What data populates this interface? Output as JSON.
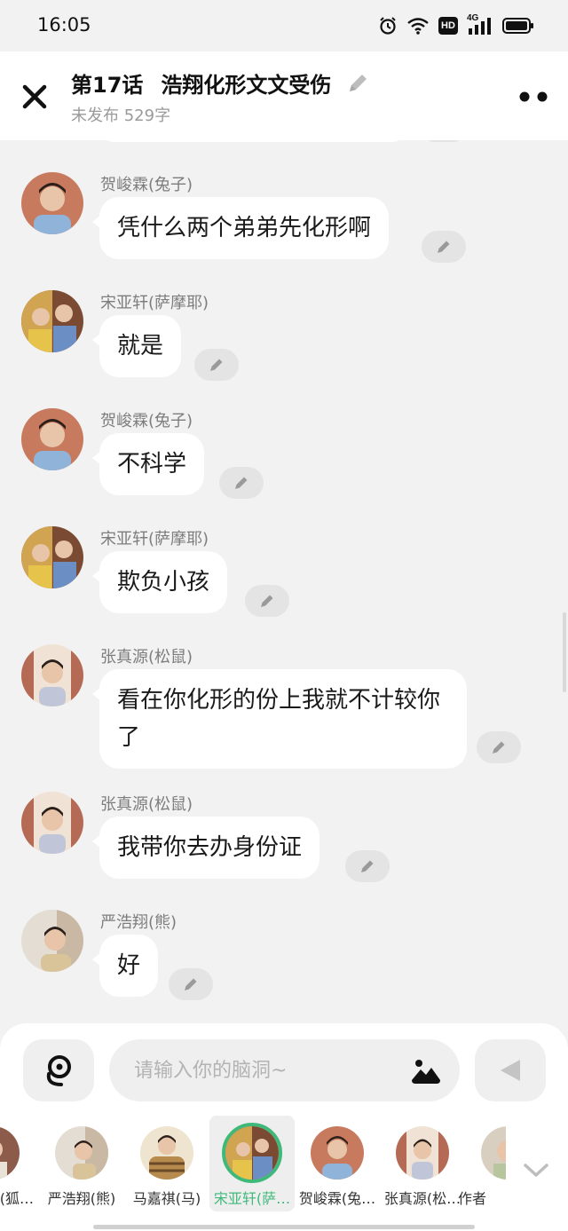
{
  "status_bar": {
    "time": "16:05",
    "icons": [
      "alarm-icon",
      "wifi-icon",
      "hd-icon",
      "4g-signal-icon",
      "battery-icon"
    ],
    "hd_label": "HD",
    "network_label": "4G"
  },
  "header": {
    "episode": "第17话",
    "title": "浩翔化形文文受伤",
    "subtitle": "未发布 529字"
  },
  "messages": [
    {
      "sender": "贺峻霖(兔子)",
      "text": "凭什么两个弟弟先化形啊",
      "avatar_color": "#c77a5e"
    },
    {
      "sender": "宋亚轩(萨摩耶)",
      "text": "就是",
      "avatar_color": "#d1a451"
    },
    {
      "sender": "贺峻霖(兔子)",
      "text": "不科学",
      "avatar_color": "#c77a5e"
    },
    {
      "sender": "宋亚轩(萨摩耶)",
      "text": "欺负小孩",
      "avatar_color": "#d1a451"
    },
    {
      "sender": "张真源(松鼠)",
      "text": "看在你化形的份上我就不计较你了",
      "avatar_color": "#b56a55"
    },
    {
      "sender": "张真源(松鼠)",
      "text": "我带你去办身份证",
      "avatar_color": "#b56a55"
    },
    {
      "sender": "严浩翔(熊)",
      "text": "好",
      "avatar_color": "#c9b9a4"
    }
  ],
  "input": {
    "placeholder": "请输入你的脑洞~"
  },
  "roles": [
    {
      "name": "(狐…",
      "color": "#8d5b4a",
      "selected": false
    },
    {
      "name": "严浩翔(熊)",
      "color": "#c9b9a4",
      "selected": false
    },
    {
      "name": "马嘉祺(马)",
      "color": "#b78a4e",
      "selected": false
    },
    {
      "name": "宋亚轩(萨…",
      "color": "#d1a451",
      "selected": true
    },
    {
      "name": "贺峻霖(兔…",
      "color": "#c77a5e",
      "selected": false
    },
    {
      "name": "张真源(松…",
      "color": "#b56a55",
      "selected": false
    },
    {
      "name": "作者",
      "color": "#d8cfc0",
      "selected": false
    }
  ],
  "colors": {
    "accent_green": "#3fb97a",
    "bubble_bg": "#ffffff",
    "chat_bg": "#f2f2f2"
  }
}
